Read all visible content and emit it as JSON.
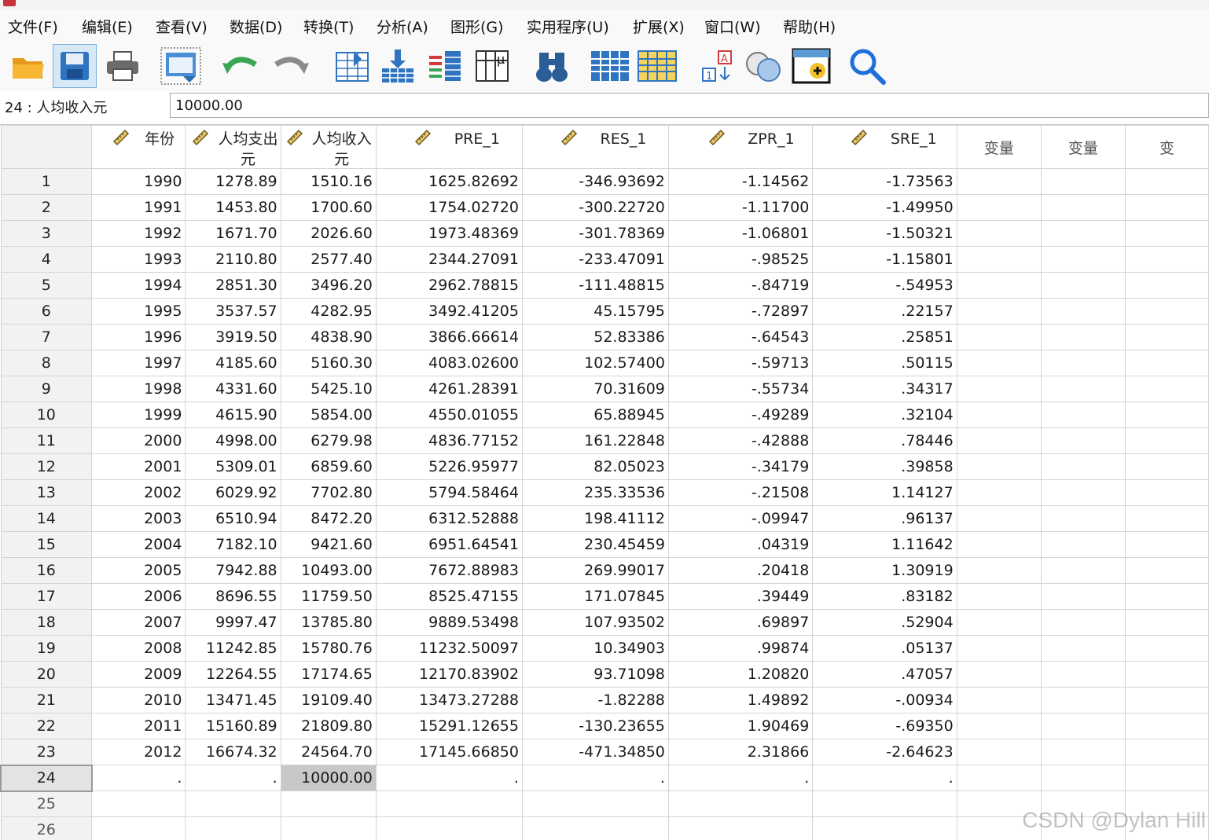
{
  "menus": [
    "文件(F)",
    "编辑(E)",
    "查看(V)",
    "数据(D)",
    "转换(T)",
    "分析(A)",
    "图形(G)",
    "实用程序(U)",
    "扩展(X)",
    "窗口(W)",
    "帮助(H)"
  ],
  "toolbar_icons": [
    "open-folder-icon",
    "save-icon",
    "print-icon",
    "dialog-recall-icon",
    "undo-icon",
    "redo-icon",
    "goto-case-icon",
    "goto-variable-icon",
    "variables-icon",
    "value-labels-icon",
    "find-icon",
    "insert-cases-icon",
    "insert-variable-icon",
    "split-file-icon",
    "select-cases-icon",
    "weight-cases-icon",
    "search-icon"
  ],
  "cell_editor": {
    "ref": "24 : 人均收入元",
    "value": "10000.00"
  },
  "grid": {
    "columns": [
      {
        "name": "年份",
        "named": true
      },
      {
        "name": "人均支出元",
        "named": true
      },
      {
        "name": "人均收入元",
        "named": true
      },
      {
        "name": "PRE_1",
        "named": true
      },
      {
        "name": "RES_1",
        "named": true
      },
      {
        "name": "ZPR_1",
        "named": true
      },
      {
        "name": "SRE_1",
        "named": true
      },
      {
        "name": "变量",
        "named": false
      },
      {
        "name": "变量",
        "named": false
      },
      {
        "name": "变",
        "named": false
      }
    ],
    "rows": [
      [
        "1",
        "1990",
        "1278.89",
        "1510.16",
        "1625.82692",
        "-346.93692",
        "-1.14562",
        "-1.73563"
      ],
      [
        "2",
        "1991",
        "1453.80",
        "1700.60",
        "1754.02720",
        "-300.22720",
        "-1.11700",
        "-1.49950"
      ],
      [
        "3",
        "1992",
        "1671.70",
        "2026.60",
        "1973.48369",
        "-301.78369",
        "-1.06801",
        "-1.50321"
      ],
      [
        "4",
        "1993",
        "2110.80",
        "2577.40",
        "2344.27091",
        "-233.47091",
        "-.98525",
        "-1.15801"
      ],
      [
        "5",
        "1994",
        "2851.30",
        "3496.20",
        "2962.78815",
        "-111.48815",
        "-.84719",
        "-.54953"
      ],
      [
        "6",
        "1995",
        "3537.57",
        "4282.95",
        "3492.41205",
        "45.15795",
        "-.72897",
        ".22157"
      ],
      [
        "7",
        "1996",
        "3919.50",
        "4838.90",
        "3866.66614",
        "52.83386",
        "-.64543",
        ".25851"
      ],
      [
        "8",
        "1997",
        "4185.60",
        "5160.30",
        "4083.02600",
        "102.57400",
        "-.59713",
        ".50115"
      ],
      [
        "9",
        "1998",
        "4331.60",
        "5425.10",
        "4261.28391",
        "70.31609",
        "-.55734",
        ".34317"
      ],
      [
        "10",
        "1999",
        "4615.90",
        "5854.00",
        "4550.01055",
        "65.88945",
        "-.49289",
        ".32104"
      ],
      [
        "11",
        "2000",
        "4998.00",
        "6279.98",
        "4836.77152",
        "161.22848",
        "-.42888",
        ".78446"
      ],
      [
        "12",
        "2001",
        "5309.01",
        "6859.60",
        "5226.95977",
        "82.05023",
        "-.34179",
        ".39858"
      ],
      [
        "13",
        "2002",
        "6029.92",
        "7702.80",
        "5794.58464",
        "235.33536",
        "-.21508",
        "1.14127"
      ],
      [
        "14",
        "2003",
        "6510.94",
        "8472.20",
        "6312.52888",
        "198.41112",
        "-.09947",
        ".96137"
      ],
      [
        "15",
        "2004",
        "7182.10",
        "9421.60",
        "6951.64541",
        "230.45459",
        ".04319",
        "1.11642"
      ],
      [
        "16",
        "2005",
        "7942.88",
        "10493.00",
        "7672.88983",
        "269.99017",
        ".20418",
        "1.30919"
      ],
      [
        "17",
        "2006",
        "8696.55",
        "11759.50",
        "8525.47155",
        "171.07845",
        ".39449",
        ".83182"
      ],
      [
        "18",
        "2007",
        "9997.47",
        "13785.80",
        "9889.53498",
        "107.93502",
        ".69897",
        ".52904"
      ],
      [
        "19",
        "2008",
        "11242.85",
        "15780.76",
        "11232.50097",
        "10.34903",
        ".99874",
        ".05137"
      ],
      [
        "20",
        "2009",
        "12264.55",
        "17174.65",
        "12170.83902",
        "93.71098",
        "1.20820",
        ".47057"
      ],
      [
        "21",
        "2010",
        "13471.45",
        "19109.40",
        "13473.27288",
        "-1.82288",
        "1.49892",
        "-.00934"
      ],
      [
        "22",
        "2011",
        "15160.89",
        "21809.80",
        "15291.12655",
        "-130.23655",
        "1.90469",
        "-.69350"
      ],
      [
        "23",
        "2012",
        "16674.32",
        "24564.70",
        "17145.66850",
        "-471.34850",
        "2.31866",
        "-2.64623"
      ],
      [
        "24",
        ".",
        ".",
        "10000.00",
        ".",
        ".",
        ".",
        "."
      ],
      [
        "25",
        "",
        "",
        "",
        "",
        "",
        "",
        ""
      ],
      [
        "26",
        "",
        "",
        "",
        "",
        "",
        "",
        ""
      ]
    ],
    "selected_row": "24",
    "selected_column": "人均收入元"
  },
  "watermark": "CSDN @Dylan Hill"
}
